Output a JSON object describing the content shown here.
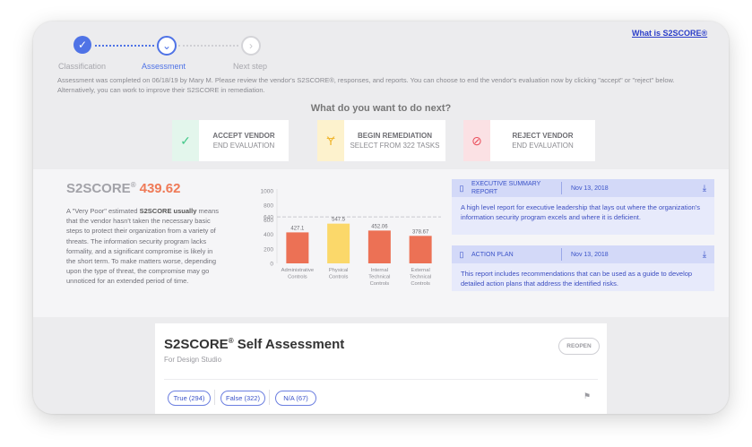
{
  "stepper": {
    "steps": [
      {
        "label": "Classification",
        "state": "done"
      },
      {
        "label": "Assessment",
        "state": "active"
      },
      {
        "label": "Next step",
        "state": "pending"
      }
    ],
    "check_glyph": "✓",
    "active_glyph": "⌄",
    "next_glyph": "›"
  },
  "help_link": "What is S2SCORE®",
  "note": "Assessment was completed on 06/18/19 by Mary M. Please review the vendor's S2SCORE®, responses, and reports. You can choose to end the vendor's evaluation now by clicking \"accept\" or \"reject\" below. Alternatively, you can work to improve their S2SCORE in remediation.",
  "next_title": "What do you want to do next?",
  "actions": [
    {
      "title": "ACCEPT VENDOR",
      "subtitle": "END EVALUATION",
      "icon": "check-icon",
      "glyph": "✓",
      "color": "#45c98a",
      "bg": "#e3f6ec"
    },
    {
      "title": "BEGIN REMEDIATION",
      "subtitle": "SELECT FROM 322 TASKS",
      "icon": "wrench-icon",
      "glyph": "Ɏ",
      "color": "#f0b62f",
      "bg": "#fdf2cd"
    },
    {
      "title": "REJECT VENDOR",
      "subtitle": "END EVALUATION",
      "icon": "block-icon",
      "glyph": "⊘",
      "color": "#ea4f5c",
      "bg": "#fbe1e4"
    }
  ],
  "score": {
    "label": "S2SCORE",
    "reg": "®",
    "value": "439.62",
    "desc_lead": "A \"Very Poor\" estimated ",
    "desc_bold": "S2SCORE usually",
    "desc_rest": " means that the vendor hasn't taken the necessary basic steps to protect their organization from a variety of threats. The information security program lacks formality, and a significant compromise is likely in the short term. To make matters worse, depending upon the type of threat, the compromise may go unnoticed for an extended period of time."
  },
  "chart_data": {
    "type": "bar",
    "categories": [
      "Administrative Controls",
      "Physical Controls",
      "Internal Technical Controls",
      "External Technical Controls"
    ],
    "category_lines": [
      [
        "Administrative",
        "Controls"
      ],
      [
        "Physical",
        "Controls"
      ],
      [
        "Internal",
        "Technical",
        "Controls"
      ],
      [
        "External",
        "Technical",
        "Controls"
      ]
    ],
    "values": [
      427.1,
      547.5,
      452.06,
      378.67
    ],
    "value_labels": [
      "427.1",
      "547.5",
      "452.06",
      "378.67"
    ],
    "colors": [
      "#ec7155",
      "#fbd86a",
      "#ec7155",
      "#ec7155"
    ],
    "ylim": [
      0,
      1000
    ],
    "yticks": [
      0,
      200,
      400,
      600,
      800,
      1000
    ],
    "reference_value": 640,
    "reference_label": "640",
    "grid": false
  },
  "reports": [
    {
      "title": "EXECUTIVE SUMMARY REPORT",
      "date": "Nov 13, 2018",
      "body": "A high level report for executive leadership that lays out where the organization's information security program excels and where it is deficient."
    },
    {
      "title": "ACTION PLAN",
      "date": "Nov 13, 2018",
      "body": "This report includes recommendations that can be used as a guide to develop detailed action plans that address the identified risks."
    }
  ],
  "self_assessment": {
    "title": "S2SCORE",
    "reg": "®",
    "title_rest": " Self Assessment",
    "subtitle": "For Design Studio",
    "reopen": "REOPEN",
    "filters": [
      "True (294)",
      "False (322)",
      "N/A (67)"
    ],
    "flag_glyph": "⚑"
  }
}
